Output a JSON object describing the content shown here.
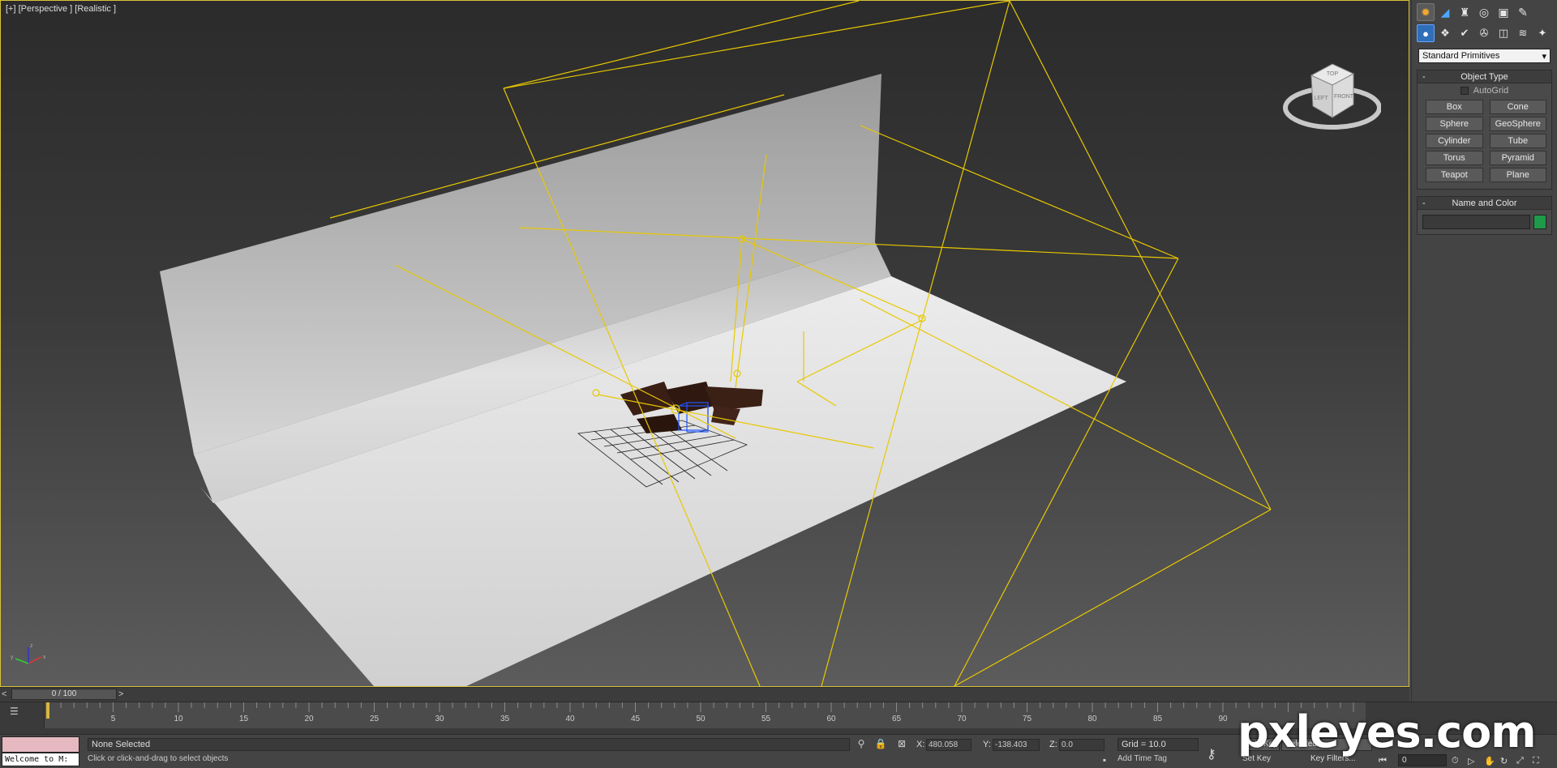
{
  "viewport": {
    "label": "[+] [Perspective ] [Realistic ]",
    "viewcube_top": "TOP",
    "viewcube_left": "LEFT",
    "viewcube_front": "FRONT",
    "axis_x": "x",
    "axis_y": "y",
    "axis_z": "z"
  },
  "colors": {
    "light_wire": "#e8c800",
    "selection": "#2255ff",
    "viewport_border": "#d9c23a",
    "object_color": "#1e9a4a"
  },
  "command_panel": {
    "tabs": [
      "sun-icon",
      "arc-icon",
      "hierarchy-icon",
      "motion-icon",
      "display-icon",
      "utilities-icon"
    ],
    "subtabs": [
      "geometry-icon",
      "shapes-icon",
      "lights-icon",
      "cameras-icon",
      "helpers-icon",
      "spacewarps-icon",
      "systems-icon"
    ],
    "category": "Standard Primitives",
    "object_type": {
      "title": "Object Type",
      "collapse_mark": "-",
      "autogrid": "AutoGrid",
      "buttons": [
        "Box",
        "Cone",
        "Sphere",
        "GeoSphere",
        "Cylinder",
        "Tube",
        "Torus",
        "Pyramid",
        "Teapot",
        "Plane"
      ]
    },
    "name_color": {
      "title": "Name and Color",
      "collapse_mark": "-"
    }
  },
  "timeline": {
    "prev": "<",
    "next": ">",
    "frame_display": "0 / 100",
    "ticks": [
      "5",
      "10",
      "15",
      "20",
      "25",
      "30",
      "35",
      "40",
      "45",
      "50",
      "55",
      "60",
      "65",
      "70",
      "75",
      "80",
      "85",
      "90"
    ]
  },
  "status": {
    "maxscript_text": "Welcome to M:",
    "selection": "None Selected",
    "prompt": "Click or click-and-drag to select objects",
    "x_label": "X:",
    "x_value": "480.058",
    "y_label": "Y:",
    "y_value": "-138.403",
    "z_label": "Z:",
    "z_value": "0.0",
    "grid": "Grid = 10.0",
    "add_time_tag": "Add Time Tag",
    "auto_key": "Auto Key",
    "set_key": "Set Key",
    "selected": "Selected",
    "key_filters": "Key Filters...",
    "current_frame": "0"
  },
  "watermark": "pxleyes.com"
}
